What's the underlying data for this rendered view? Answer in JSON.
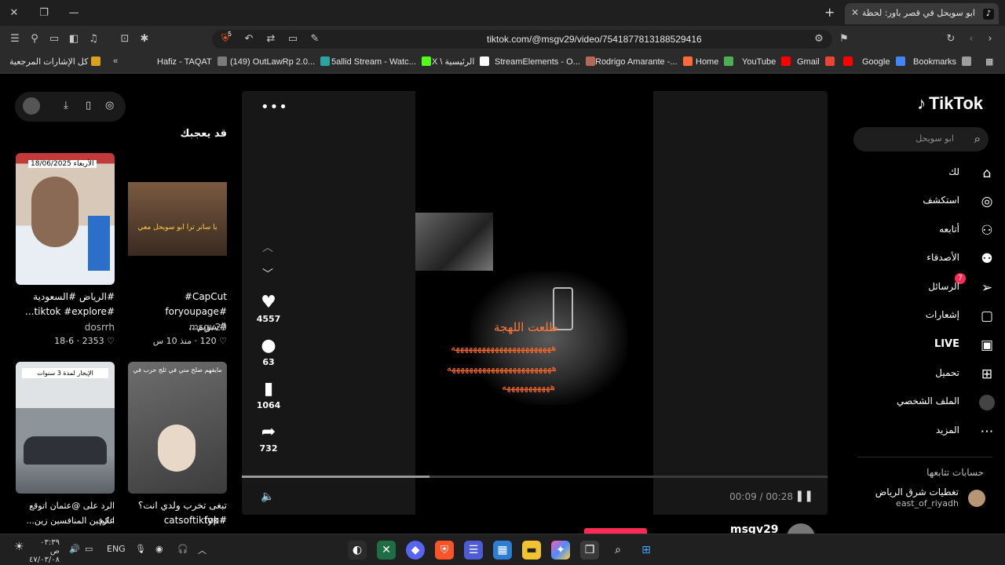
{
  "browser": {
    "tab_title": "ابو سويحل في قصر باور: لحظة",
    "url": "tiktok.com/@msgv29/video/7541877813188529416",
    "shield_count": "5",
    "bookmarks": [
      {
        "label": "كل الإشارات المرجعية",
        "color": "#d9a21b"
      },
      {
        "label": "Hafiz - TAQAT",
        "color": "#7b7b7b"
      },
      {
        "label": "(149) OutLawRp 2.0...",
        "color": "#2aa5a0"
      },
      {
        "label": "5allid Stream - Watc...",
        "color": "#53fc18"
      },
      {
        "label": "X \\ الرئيسية",
        "color": "#ffffff"
      },
      {
        "label": "StreamElements - O...",
        "color": "#b06a55"
      },
      {
        "label": "Rodrigo Amarante -...",
        "color": "#ff6a3d"
      },
      {
        "label": "Home",
        "color": "#4caf50"
      },
      {
        "label": "YouTube",
        "color": "#ff0000"
      },
      {
        "label": "Gmail",
        "color": "#ea4335"
      },
      {
        "label": "",
        "color": "#ff0000"
      },
      {
        "label": "Google",
        "color": "#4285f4"
      },
      {
        "label": "Bookmarks",
        "color": "#9e9e9e"
      }
    ]
  },
  "sidebar": {
    "logo": "TikTok",
    "search_placeholder": "ابو سويحل",
    "items": [
      {
        "label": "لك",
        "icon": "home-icon"
      },
      {
        "label": "استكشف",
        "icon": "compass-icon"
      },
      {
        "label": "أتابعه",
        "icon": "user-follow-icon"
      },
      {
        "label": "الأصدقاء",
        "icon": "friends-icon"
      },
      {
        "label": "الرسائل",
        "icon": "send-icon",
        "badge": "7"
      },
      {
        "label": "إشعارات",
        "icon": "inbox-icon"
      },
      {
        "label": "LIVE",
        "icon": "live-icon"
      },
      {
        "label": "تحميل",
        "icon": "upload-icon"
      },
      {
        "label": "الملف الشخصي",
        "icon": "profile-icon"
      },
      {
        "label": "المزيد",
        "icon": "more-icon"
      }
    ],
    "following_title": "حسابات تتابعها",
    "following": [
      {
        "name": "تغطيات شرق الرياض",
        "handle": "east_of_riyadh"
      }
    ]
  },
  "video": {
    "caption_top": "طلعت اللهجة",
    "caption_lines": [
      "هههههههههههههههههههههههه",
      "ههههههههههههههههههههههههه",
      "هههههههههههه"
    ],
    "likes": "4557",
    "comments": "63",
    "saves": "1064",
    "shares": "732",
    "time": "00:09 / 00:28",
    "progress_fraction": 0.32,
    "author": "msgv29"
  },
  "recommend": {
    "title": "قد يعجبك",
    "cards": [
      {
        "title_1": "CapCut#",
        "title_2": "#foryoupage #سويم...",
        "author": "msgv29",
        "stats": "120 · منذ 10 س",
        "thumb_text": "يا ساتر ترا ابو سويحل معي"
      },
      {
        "title_1": "#الرياض #السعودية",
        "title_2": "#tiktok #explore...",
        "author": "dosrrh",
        "stats": "2353 · 18-6",
        "thumb_text": "الأربعاء 18/06/2025"
      },
      {
        "title_1": "تبغى تخرب ولدي انت؟ #fyp",
        "title_2": "#catsoftiktok",
        "author": "",
        "stats": "",
        "thumb_text": "مايفهم صلح مني في ثلج حرب في"
      },
      {
        "title_1": "الرد على @عثمان اتوقع انكم",
        "title_2": "عارفين المنافسين زين...",
        "author": "",
        "stats": "",
        "thumb_text": "الإيجار لمدة 3 سنوات"
      }
    ]
  },
  "taskbar": {
    "time": "٠٣:٣٩ ص",
    "date": "٤٧/٠٣/٠٨",
    "lang": "ENG"
  }
}
